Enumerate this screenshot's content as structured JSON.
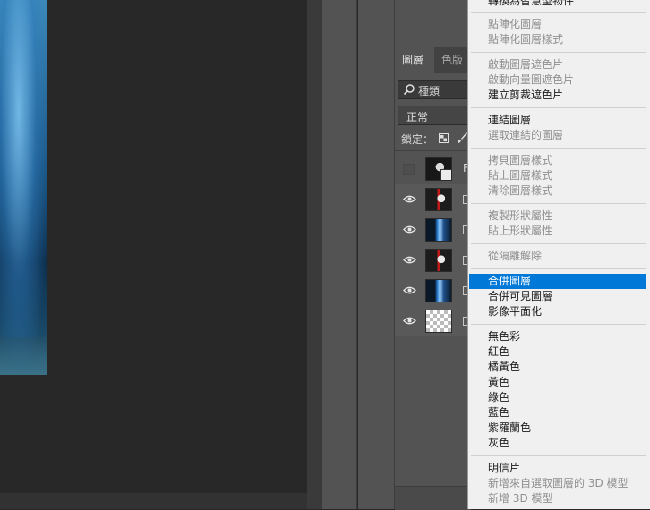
{
  "layers_panel": {
    "tabs": [
      "圖層",
      "色版"
    ],
    "filter_label": "種類",
    "blend_mode": "正常",
    "lock_label": "鎖定：",
    "first_layer_name_fragment": "F"
  },
  "context_menu": {
    "top_fragment": "轉換為智慧型物件",
    "groups": [
      [
        {
          "label": "點陣化圖層",
          "enabled": false
        },
        {
          "label": "點陣化圖層樣式",
          "enabled": false
        }
      ],
      [
        {
          "label": "啟動圖層遮色片",
          "enabled": false
        },
        {
          "label": "啟動向量圖遮色片",
          "enabled": false
        },
        {
          "label": "建立剪裁遮色片",
          "enabled": true
        }
      ],
      [
        {
          "label": "連結圖層",
          "enabled": true
        },
        {
          "label": "選取連結的圖層",
          "enabled": false
        }
      ],
      [
        {
          "label": "拷貝圖層樣式",
          "enabled": false
        },
        {
          "label": "貼上圖層樣式",
          "enabled": false
        },
        {
          "label": "清除圖層樣式",
          "enabled": false
        }
      ],
      [
        {
          "label": "複製形狀屬性",
          "enabled": false
        },
        {
          "label": "貼上形狀屬性",
          "enabled": false
        }
      ],
      [
        {
          "label": "從隔離解除",
          "enabled": false
        }
      ],
      [
        {
          "label": "合併圖層",
          "enabled": true,
          "highlighted": true
        },
        {
          "label": "合併可見圖層",
          "enabled": true
        },
        {
          "label": "影像平面化",
          "enabled": true
        }
      ],
      [
        {
          "label": "無色彩",
          "enabled": true
        },
        {
          "label": "紅色",
          "enabled": true
        },
        {
          "label": "橘黃色",
          "enabled": true
        },
        {
          "label": "黃色",
          "enabled": true
        },
        {
          "label": "綠色",
          "enabled": true
        },
        {
          "label": "藍色",
          "enabled": true
        },
        {
          "label": "紫羅蘭色",
          "enabled": true
        },
        {
          "label": "灰色",
          "enabled": true
        }
      ],
      [
        {
          "label": "明信片",
          "enabled": true
        },
        {
          "label": "新增來自選取圖層的 3D 模型",
          "enabled": false
        },
        {
          "label": "新增 3D 模型",
          "enabled": false
        }
      ]
    ]
  }
}
